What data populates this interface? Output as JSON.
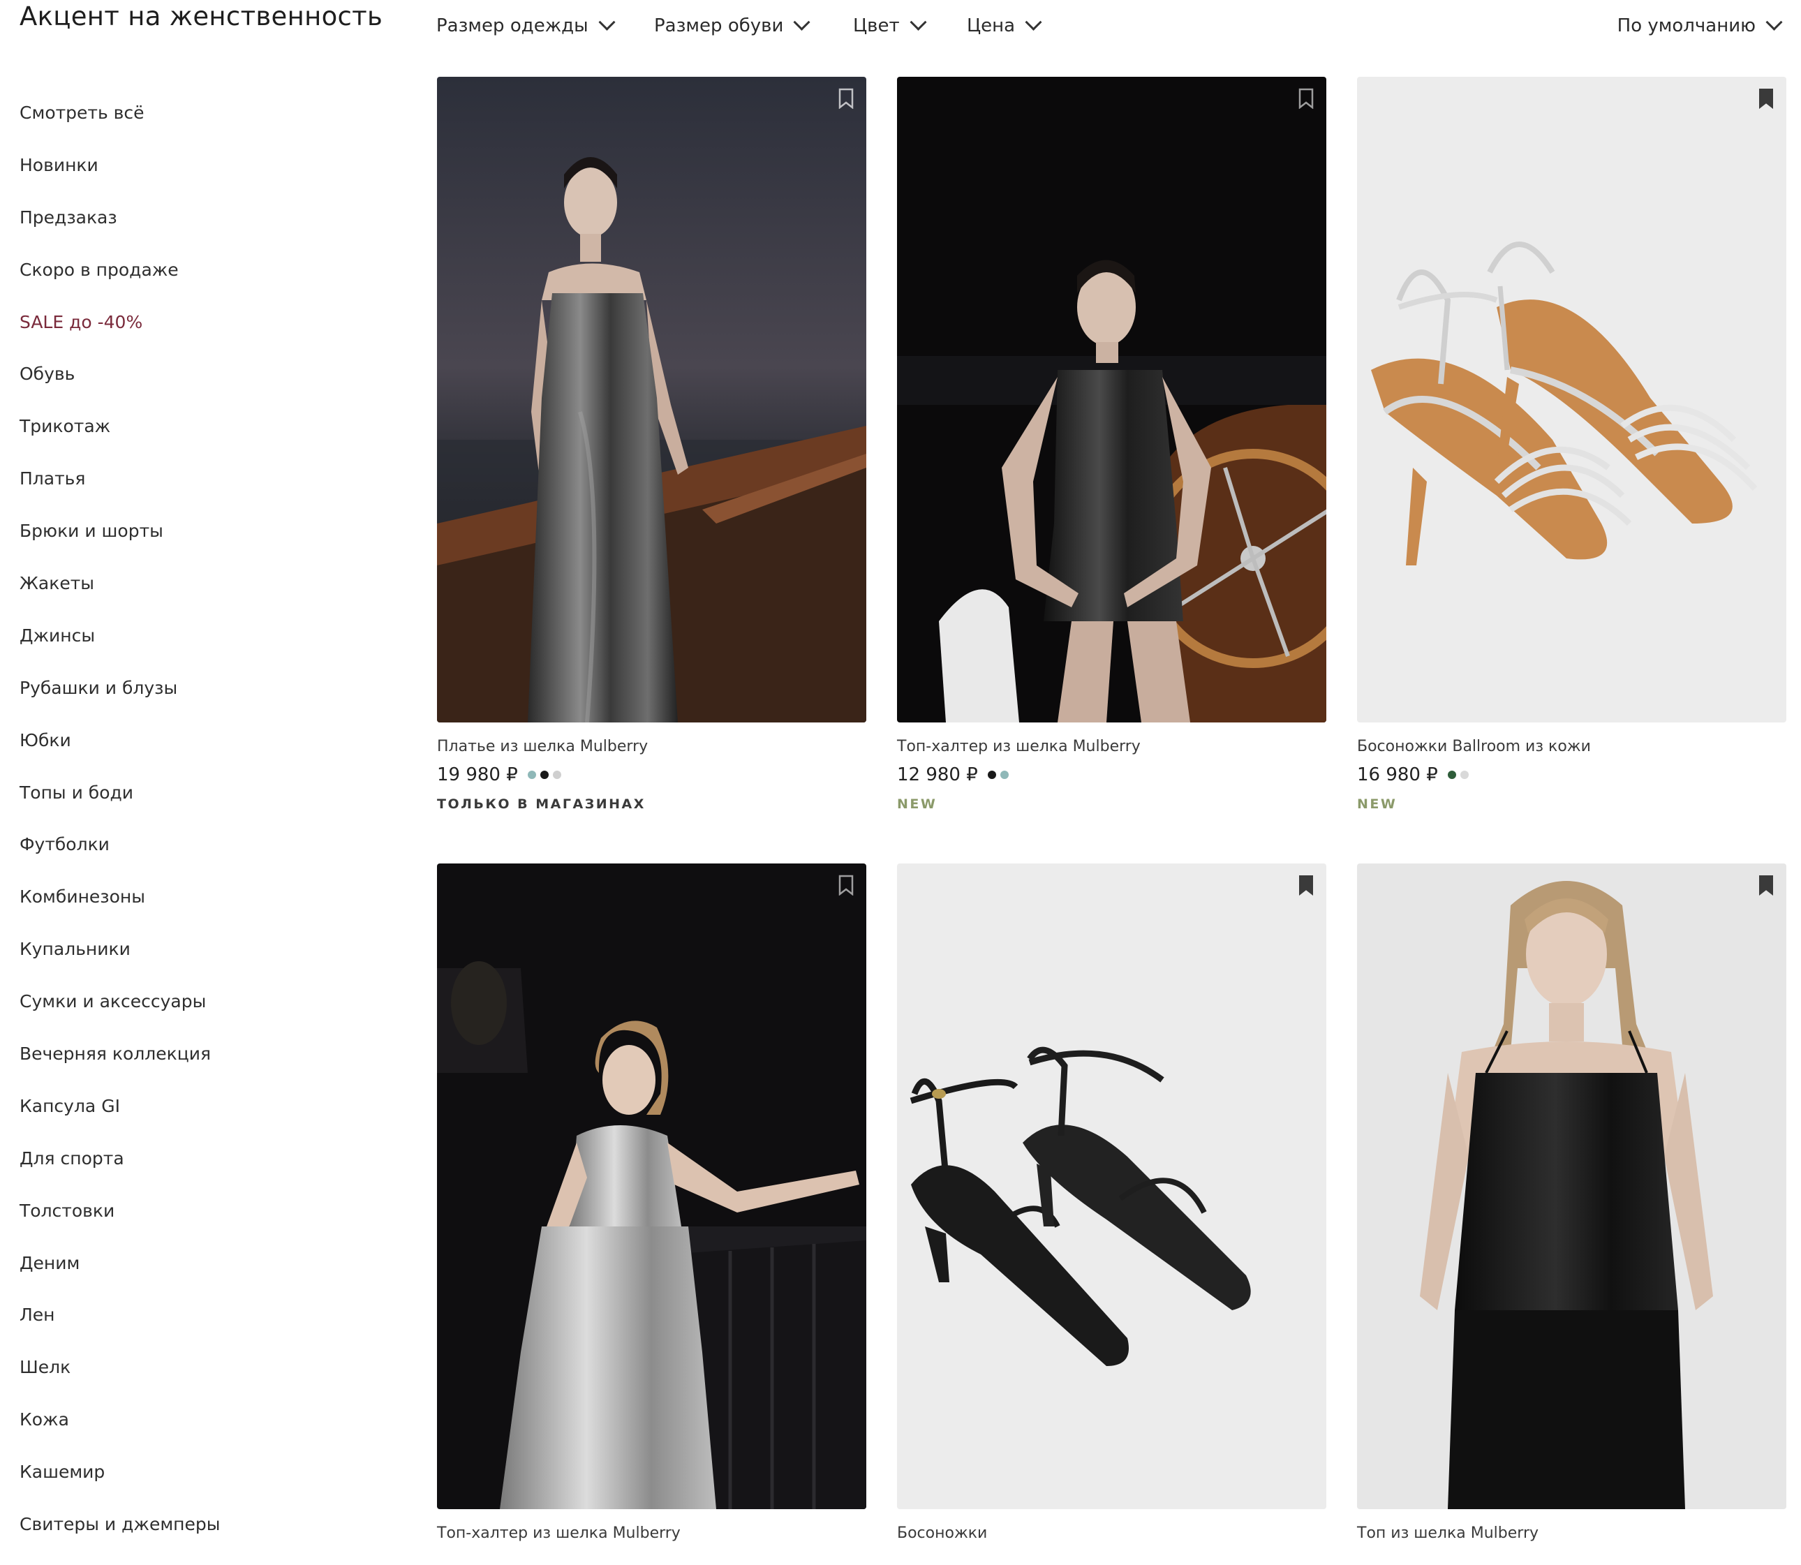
{
  "page": {
    "title": "Акцент на женственность"
  },
  "filters": [
    {
      "label": "Размер одежды"
    },
    {
      "label": "Размер обуви"
    },
    {
      "label": "Цвет"
    },
    {
      "label": "Цена"
    }
  ],
  "sort": {
    "label": "По умолчанию"
  },
  "sidebar": {
    "items": [
      {
        "label": "Смотреть всё"
      },
      {
        "label": "Новинки"
      },
      {
        "label": "Предзаказ"
      },
      {
        "label": "Скоро в продаже"
      },
      {
        "label": "SALE до -40%"
      },
      {
        "label": "Обувь"
      },
      {
        "label": "Трикотаж"
      },
      {
        "label": "Платья"
      },
      {
        "label": "Брюки и шорты"
      },
      {
        "label": "Жакеты"
      },
      {
        "label": "Джинсы"
      },
      {
        "label": "Рубашки и блузы"
      },
      {
        "label": "Юбки"
      },
      {
        "label": "Топы и боди"
      },
      {
        "label": "Футболки"
      },
      {
        "label": "Комбинезоны"
      },
      {
        "label": "Купальники"
      },
      {
        "label": "Сумки и аксессуары"
      },
      {
        "label": "Вечерняя коллекция"
      },
      {
        "label": "Капсула GI"
      },
      {
        "label": "Для спорта"
      },
      {
        "label": "Толстовки"
      },
      {
        "label": "Деним"
      },
      {
        "label": "Лен"
      },
      {
        "label": "Шелк"
      },
      {
        "label": "Кожа"
      },
      {
        "label": "Кашемир"
      },
      {
        "label": "Свитеры и джемперы"
      }
    ]
  },
  "products": [
    {
      "name": "Платье из шелка Mulberry",
      "price": "19 980 ₽",
      "swatches": [
        "#8fb8b8",
        "#1a1a1a",
        "#cfcfcf"
      ],
      "badge": "ТОЛЬКО В МАГАЗИНАХ"
    },
    {
      "name": "Топ-халтер из шелка Mulberry",
      "price": "12 980 ₽",
      "swatches": [
        "#1a1a1a",
        "#8fb8b8"
      ],
      "badge": "NEW"
    },
    {
      "name": "Босоножки Ballroom из кожи",
      "price": "16 980 ₽",
      "swatches": [
        "#2f5d3a",
        "#d9d9d9"
      ],
      "badge": "NEW"
    },
    {
      "name": "Топ-халтер из шелка Mulberry"
    },
    {
      "name": "Босоножки"
    },
    {
      "name": "Топ из шелка Mulberry"
    }
  ]
}
